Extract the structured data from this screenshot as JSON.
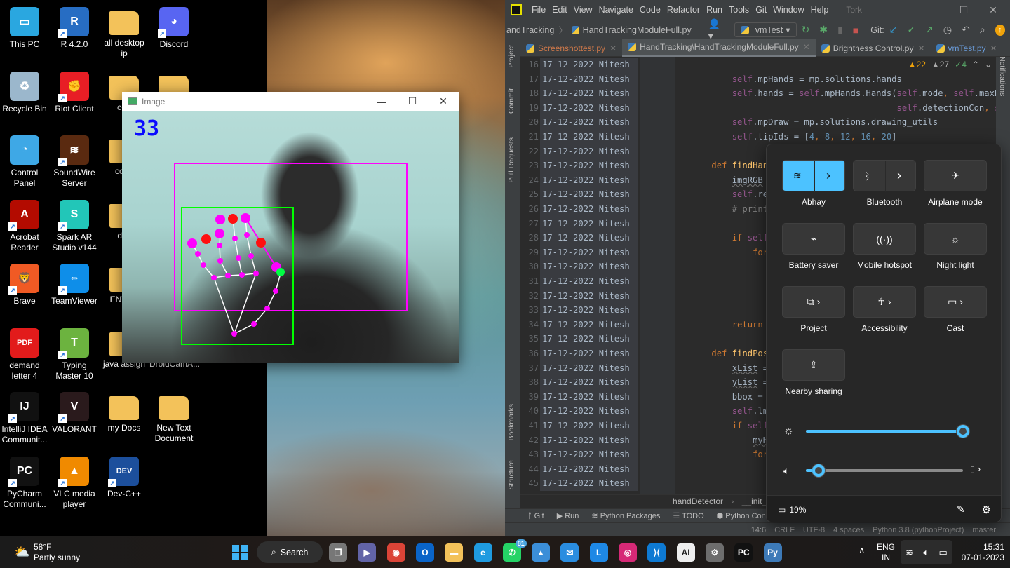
{
  "desktop": {
    "icons": [
      {
        "label": "This PC",
        "icon": "monitor-icon",
        "color": "#2aa7e0",
        "glyph": "▭",
        "col": 0,
        "row": 0,
        "shortcut": false
      },
      {
        "label": "Recycle Bin",
        "icon": "recycle-bin-icon",
        "color": "#9bb7cc",
        "glyph": "♻",
        "col": 0,
        "row": 1,
        "shortcut": false
      },
      {
        "label": "Control Panel",
        "icon": "control-panel-icon",
        "color": "#3ea8e6",
        "glyph": "◔",
        "col": 0,
        "row": 2,
        "shortcut": false
      },
      {
        "label": "Acrobat Reader",
        "icon": "acrobat-icon",
        "color": "#b30b00",
        "glyph": "A",
        "col": 0,
        "row": 3,
        "shortcut": true
      },
      {
        "label": "Brave",
        "icon": "brave-icon",
        "color": "#f05a24",
        "glyph": "🦁",
        "col": 0,
        "row": 4,
        "shortcut": true
      },
      {
        "label": "demand letter 4",
        "icon": "pdf-file-icon",
        "color": "#e21b1b",
        "glyph": "PDF",
        "col": 0,
        "row": 5,
        "shortcut": false
      },
      {
        "label": "IntelliJ IDEA Communit...",
        "icon": "intellij-icon",
        "color": "#111",
        "glyph": "IJ",
        "col": 0,
        "row": 6,
        "shortcut": true
      },
      {
        "label": "PyCharm Communi...",
        "icon": "pycharm-icon",
        "color": "#111",
        "glyph": "PC",
        "col": 0,
        "row": 7,
        "shortcut": true
      },
      {
        "label": "R 4.2.0",
        "icon": "r-icon",
        "color": "#276dc3",
        "glyph": "R",
        "col": 1,
        "row": 0,
        "shortcut": true
      },
      {
        "label": "Riot Client",
        "icon": "riot-icon",
        "color": "#e81e25",
        "glyph": "✊",
        "col": 1,
        "row": 1,
        "shortcut": true
      },
      {
        "label": "SoundWire Server",
        "icon": "soundwire-icon",
        "color": "#5a2a10",
        "glyph": "≋",
        "col": 1,
        "row": 2,
        "shortcut": true
      },
      {
        "label": "Spark AR Studio v144",
        "icon": "spark-ar-icon",
        "color": "#22c6b8",
        "glyph": "S",
        "col": 1,
        "row": 3,
        "shortcut": true
      },
      {
        "label": "TeamViewer",
        "icon": "teamviewer-icon",
        "color": "#0e8ee9",
        "glyph": "⇔",
        "col": 1,
        "row": 4,
        "shortcut": true
      },
      {
        "label": "Typing Master 10",
        "icon": "typing-master-icon",
        "color": "#6cb33f",
        "glyph": "T",
        "col": 1,
        "row": 5,
        "shortcut": true
      },
      {
        "label": "VALORANT",
        "icon": "valorant-icon",
        "color": "#2a1a1c",
        "glyph": "V",
        "col": 1,
        "row": 6,
        "shortcut": true
      },
      {
        "label": "VLC media player",
        "icon": "vlc-icon",
        "color": "#f08a00",
        "glyph": "▲",
        "col": 1,
        "row": 7,
        "shortcut": true
      },
      {
        "label": "all desktop ip",
        "icon": "folder-icon",
        "color": "#f3c25a",
        "glyph": "",
        "col": 2,
        "row": 0,
        "shortcut": false
      },
      {
        "label": "c++",
        "icon": "folder-icon",
        "color": "#f3c25a",
        "glyph": "",
        "col": 2,
        "row": 1,
        "shortcut": false
      },
      {
        "label": "code",
        "icon": "folder-icon",
        "color": "#f3c25a",
        "glyph": "",
        "col": 2,
        "row": 2,
        "shortcut": false
      },
      {
        "label": "dsa",
        "icon": "folder-icon",
        "color": "#f3c25a",
        "glyph": "",
        "col": 2,
        "row": 3,
        "shortcut": false
      },
      {
        "label": "ENTER",
        "icon": "folder-icon",
        "color": "#f3c25a",
        "glyph": "",
        "col": 2,
        "row": 4,
        "shortcut": false
      },
      {
        "label": "java assign",
        "icon": "folder-icon",
        "color": "#f3c25a",
        "glyph": "",
        "col": 2,
        "row": 5,
        "shortcut": false
      },
      {
        "label": "my Docs",
        "icon": "folder-icon",
        "color": "#f3c25a",
        "glyph": "",
        "col": 2,
        "row": 6,
        "shortcut": false
      },
      {
        "label": "Dev-C++",
        "icon": "dev-cpp-icon",
        "color": "#1c4f9c",
        "glyph": "DEV",
        "col": 2,
        "row": 7,
        "shortcut": true
      },
      {
        "label": "Discord",
        "icon": "discord-icon",
        "color": "#5865f2",
        "glyph": "◕",
        "col": 3,
        "row": 0,
        "shortcut": true
      },
      {
        "label": "",
        "icon": "zip-folder-icon",
        "color": "#f3c25a",
        "glyph": "",
        "col": 3,
        "row": 1,
        "shortcut": false
      },
      {
        "label": "DroidCamA...",
        "icon": "folder-icon",
        "color": "#f3c25a",
        "glyph": "",
        "col": 3,
        "row": 5,
        "shortcut": false
      },
      {
        "label": "New Text Document",
        "icon": "zip-folder-icon",
        "color": "#f3c25a",
        "glyph": "",
        "col": 3,
        "row": 6,
        "shortcut": false
      }
    ]
  },
  "image_window": {
    "title": "Image",
    "overlay_text": "33",
    "overlay_color": "#0a0aff",
    "bbox_color": "#ff00ff",
    "hand_box_color": "#00ff00"
  },
  "pycharm": {
    "menu": [
      "File",
      "Edit",
      "View",
      "Navigate",
      "Code",
      "Refactor",
      "Run",
      "Tools",
      "Git",
      "Window",
      "Help"
    ],
    "project_name": "Tork",
    "breadcrumb": [
      "andTracking",
      "HandTrackingModuleFull.py"
    ],
    "run_config": "vmTest",
    "git_label": "Git:",
    "tabs": [
      {
        "label": "Screenshottest.py",
        "active": false,
        "color": "#d0794a"
      },
      {
        "label": "HandTracking\\HandTrackingModuleFull.py",
        "active": true,
        "color": "#bbbbbb"
      },
      {
        "label": "Brightness Control.py",
        "active": false,
        "color": "#bbbbbb"
      },
      {
        "label": "vmTest.py",
        "active": false,
        "color": "#6a9bd8"
      }
    ],
    "left_tools": [
      "Project",
      "Commit",
      "Pull Requests",
      "Bookmarks",
      "Structure"
    ],
    "right_tools": [
      "Notifications"
    ],
    "inspections": {
      "warnings": "22",
      "weak_warnings": "27",
      "ok": "4"
    },
    "annotation": "17-12-2022 Nitesh",
    "lines": [
      {
        "n": "16",
        "seg": []
      },
      {
        "n": "17",
        "seg": [
          [
            "        ",
            ""
          ],
          [
            "self",
            "s"
          ],
          [
            ".mpHands = mp.solutions.hands",
            ""
          ]
        ]
      },
      {
        "n": "18",
        "seg": [
          [
            "        ",
            ""
          ],
          [
            "self",
            "s"
          ],
          [
            ".hands = ",
            ""
          ],
          [
            "self",
            "s"
          ],
          [
            ".mpHands.Hands(",
            ""
          ],
          [
            "self",
            "s"
          ],
          [
            ".mode",
            ""
          ],
          [
            ", ",
            "k"
          ],
          [
            "self",
            "s"
          ],
          [
            ".maxHan",
            ""
          ]
        ]
      },
      {
        "n": "19",
        "seg": [
          [
            "                                        ",
            ""
          ],
          [
            "self",
            "s"
          ],
          [
            ".detectionCon",
            ""
          ],
          [
            ", ",
            "k"
          ],
          [
            "sel",
            "s"
          ]
        ]
      },
      {
        "n": "20",
        "seg": [
          [
            "        ",
            ""
          ],
          [
            "self",
            "s"
          ],
          [
            ".mpDraw = mp.solutions.drawing_utils",
            ""
          ]
        ]
      },
      {
        "n": "21",
        "seg": [
          [
            "        ",
            ""
          ],
          [
            "self",
            "s"
          ],
          [
            ".tipIds = [",
            ""
          ],
          [
            "4",
            "n"
          ],
          [
            ", ",
            "k"
          ],
          [
            "8",
            "n"
          ],
          [
            ", ",
            "k"
          ],
          [
            "12",
            "n"
          ],
          [
            ", ",
            "k"
          ],
          [
            "16",
            "n"
          ],
          [
            ", ",
            "k"
          ],
          [
            "20",
            "n"
          ],
          [
            "]",
            ""
          ]
        ]
      },
      {
        "n": "22",
        "seg": []
      },
      {
        "n": "23",
        "seg": [
          [
            "    ",
            ""
          ],
          [
            "def ",
            "k"
          ],
          [
            "findHands",
            "f"
          ],
          [
            "(s",
            ""
          ]
        ]
      },
      {
        "n": "24",
        "seg": [
          [
            "        ",
            ""
          ],
          [
            "imgRGB",
            "u"
          ],
          [
            " = cv",
            ""
          ]
        ]
      },
      {
        "n": "25",
        "seg": [
          [
            "        ",
            ""
          ],
          [
            "self",
            "s"
          ],
          [
            ".resul",
            ""
          ]
        ]
      },
      {
        "n": "26",
        "seg": [
          [
            "        ",
            ""
          ],
          [
            "# print(res",
            "c"
          ]
        ]
      },
      {
        "n": "27",
        "seg": []
      },
      {
        "n": "28",
        "seg": [
          [
            "        ",
            ""
          ],
          [
            "if ",
            "k"
          ],
          [
            "self",
            "s"
          ],
          [
            ".res",
            ""
          ]
        ]
      },
      {
        "n": "29",
        "seg": [
          [
            "            ",
            ""
          ],
          [
            "for ",
            "k"
          ],
          [
            "han",
            ""
          ]
        ]
      },
      {
        "n": "30",
        "seg": [
          [
            "                ",
            ""
          ],
          [
            "if",
            "k"
          ]
        ]
      },
      {
        "n": "31",
        "seg": []
      },
      {
        "n": "32",
        "seg": []
      },
      {
        "n": "33",
        "seg": []
      },
      {
        "n": "34",
        "seg": [
          [
            "        ",
            ""
          ],
          [
            "return ",
            "k"
          ],
          [
            "img",
            ""
          ]
        ]
      },
      {
        "n": "35",
        "seg": []
      },
      {
        "n": "36",
        "seg": [
          [
            "    ",
            ""
          ],
          [
            "def ",
            "k"
          ],
          [
            "findPositi",
            "f"
          ]
        ]
      },
      {
        "n": "37",
        "seg": [
          [
            "        ",
            ""
          ],
          [
            "xList",
            "u"
          ],
          [
            " = []",
            ""
          ]
        ]
      },
      {
        "n": "38",
        "seg": [
          [
            "        ",
            ""
          ],
          [
            "yList",
            "u"
          ],
          [
            " = []",
            ""
          ]
        ]
      },
      {
        "n": "39",
        "seg": [
          [
            "        ",
            ""
          ],
          [
            "bbox = []",
            ""
          ]
        ]
      },
      {
        "n": "40",
        "seg": [
          [
            "        ",
            ""
          ],
          [
            "self",
            "s"
          ],
          [
            ".lmLis",
            ""
          ]
        ]
      },
      {
        "n": "41",
        "seg": [
          [
            "        ",
            ""
          ],
          [
            "if ",
            "k"
          ],
          [
            "self",
            "s"
          ],
          [
            ".res",
            ""
          ]
        ]
      },
      {
        "n": "42",
        "seg": [
          [
            "            ",
            ""
          ],
          [
            "myHand",
            "u"
          ]
        ]
      },
      {
        "n": "43",
        "seg": [
          [
            "            ",
            ""
          ],
          [
            "for ",
            "k"
          ],
          [
            "id",
            ""
          ]
        ]
      },
      {
        "n": "44",
        "seg": [
          [
            "                ",
            ""
          ],
          [
            "# ",
            "c"
          ]
        ]
      },
      {
        "n": "45",
        "seg": [
          [
            "                ",
            ""
          ],
          [
            "h,",
            ""
          ]
        ]
      }
    ],
    "code_breadcrumb": [
      "handDetector",
      "__init__()"
    ],
    "tool_tabs": [
      "Git",
      "Run",
      "Python Packages",
      "TODO",
      "Python Conso"
    ],
    "status": [
      "14:6",
      "CRLF",
      "UTF-8",
      "4 spaces",
      "Python 3.8 (pythonProject)",
      "master"
    ]
  },
  "quick_settings": {
    "accent": "#4cc2ff",
    "tiles": [
      {
        "label": "Abhay",
        "icon": "wifi-icon",
        "glyph": "≋",
        "on": true,
        "split": true
      },
      {
        "label": "Bluetooth",
        "icon": "bluetooth-icon",
        "glyph": "ᛒ",
        "on": false,
        "split": true
      },
      {
        "label": "Airplane mode",
        "icon": "airplane-icon",
        "glyph": "✈",
        "on": false,
        "split": false
      },
      {
        "label": "Battery saver",
        "icon": "battery-saver-icon",
        "glyph": "⌁",
        "on": false,
        "split": false
      },
      {
        "label": "Mobile hotspot",
        "icon": "hotspot-icon",
        "glyph": "((·))",
        "on": false,
        "split": false
      },
      {
        "label": "Night light",
        "icon": "night-light-icon",
        "glyph": "☼",
        "on": false,
        "split": false
      },
      {
        "label": "Project",
        "icon": "project-icon",
        "glyph": "⧉ ›",
        "on": false,
        "split": false
      },
      {
        "label": "Accessibility",
        "icon": "accessibility-icon",
        "glyph": "☥ ›",
        "on": false,
        "split": false
      },
      {
        "label": "Cast",
        "icon": "cast-icon",
        "glyph": "▭ ›",
        "on": false,
        "split": false
      },
      {
        "label": "Nearby sharing",
        "icon": "share-icon",
        "glyph": "⇪",
        "on": false,
        "split": false
      }
    ],
    "brightness_percent": 100,
    "volume_percent": 8,
    "battery": "19%"
  },
  "taskbar": {
    "weather": {
      "temp": "58°F",
      "desc": "Partly sunny"
    },
    "search_label": "Search",
    "apps": [
      {
        "name": "task-view",
        "color": "#777",
        "glyph": "❐"
      },
      {
        "name": "teams-chat",
        "color": "#6264a7",
        "glyph": "▶"
      },
      {
        "name": "chrome",
        "color": "#db4437",
        "glyph": "◉"
      },
      {
        "name": "outlook",
        "color": "#0a64c8",
        "glyph": "O"
      },
      {
        "name": "file-explorer",
        "color": "#f3c25a",
        "glyph": "▬"
      },
      {
        "name": "edge",
        "color": "#1f9be0",
        "glyph": "e"
      },
      {
        "name": "whatsapp",
        "color": "#25d366",
        "glyph": "✆",
        "badge": "81"
      },
      {
        "name": "photos",
        "color": "#3b8ed8",
        "glyph": "▲"
      },
      {
        "name": "mail",
        "color": "#2a8de0",
        "glyph": "✉"
      },
      {
        "name": "lingoes",
        "color": "#1e88e5",
        "glyph": "L"
      },
      {
        "name": "instagram",
        "color": "#d62976",
        "glyph": "◎"
      },
      {
        "name": "vscode",
        "color": "#0e7ad3",
        "glyph": "⟩⟨"
      },
      {
        "name": "ai-app",
        "color": "#eeeeee",
        "glyph": "AI"
      },
      {
        "name": "settings",
        "color": "#6d6d6d",
        "glyph": "⚙"
      },
      {
        "name": "pycharm",
        "color": "#111",
        "glyph": "PC"
      },
      {
        "name": "python",
        "color": "#3d7ab8",
        "glyph": "Py"
      }
    ],
    "lang": [
      "ENG",
      "IN"
    ],
    "time": "15:31",
    "date": "07-01-2023"
  }
}
